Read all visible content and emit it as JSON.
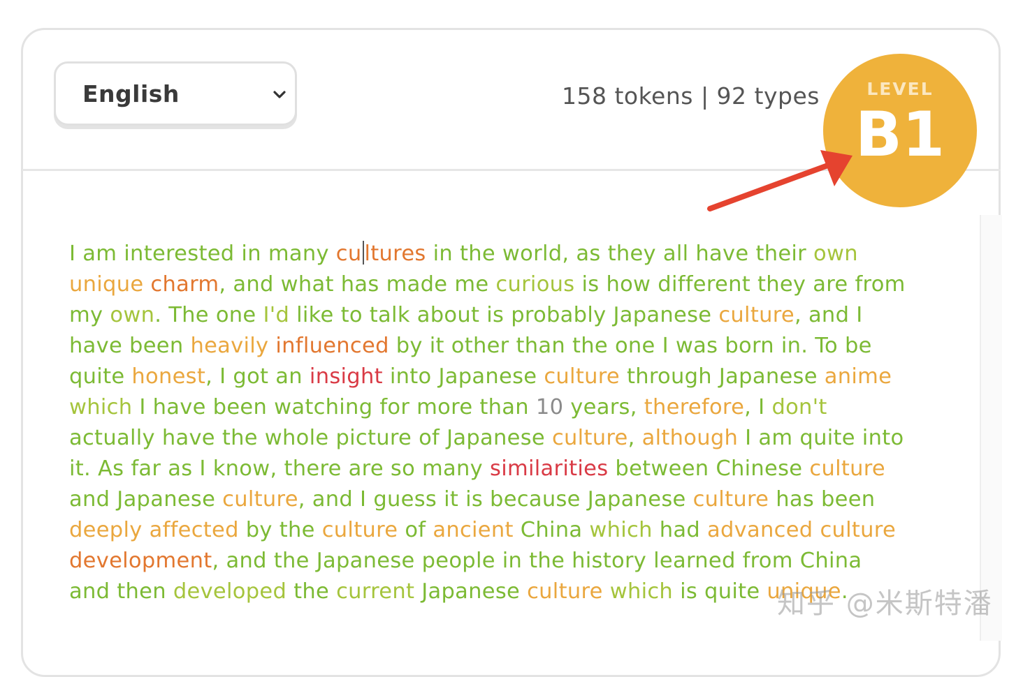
{
  "language_select": {
    "value": "English"
  },
  "stats": {
    "text": "158 tokens | 92 types"
  },
  "level": {
    "label": "LEVEL",
    "value": "B1",
    "color": "#efb23b"
  },
  "level_colors": {
    "green": "#7cba34",
    "yellow_green": "#a5c43c",
    "orange": "#eaa73e",
    "dark_orange": "#e2772f",
    "red": "#d93a45",
    "grey": "#8a8a8a"
  },
  "text_lines": [
    [
      [
        "I am interested in many ",
        "g"
      ],
      [
        "cu",
        "d"
      ],
      [
        "|caret",
        "caret"
      ],
      [
        "ltures",
        "d"
      ],
      [
        " in the world, as they all have their ",
        "g"
      ],
      [
        "own",
        "y"
      ]
    ],
    [
      [
        "unique",
        "o"
      ],
      [
        " ",
        "g"
      ],
      [
        "charm",
        "d"
      ],
      [
        ", and what has made me ",
        "g"
      ],
      [
        "curious",
        "y"
      ],
      [
        " is how different they are from",
        "g"
      ]
    ],
    [
      [
        "my ",
        "g"
      ],
      [
        "own",
        "y"
      ],
      [
        ". The one ",
        "g"
      ],
      [
        "I'd",
        "y"
      ],
      [
        " like to talk about is probably Japanese ",
        "g"
      ],
      [
        "culture",
        "o"
      ],
      [
        ", and I",
        "g"
      ]
    ],
    [
      [
        "have been ",
        "g"
      ],
      [
        "heavily",
        "o"
      ],
      [
        " ",
        "g"
      ],
      [
        "influenced",
        "d"
      ],
      [
        " by it other than the one I was born in. To be",
        "g"
      ]
    ],
    [
      [
        "quite ",
        "g"
      ],
      [
        "honest",
        "o"
      ],
      [
        ", I got an ",
        "g"
      ],
      [
        "insight",
        "r"
      ],
      [
        " into Japanese ",
        "g"
      ],
      [
        "culture",
        "o"
      ],
      [
        " through Japanese ",
        "g"
      ],
      [
        "anime",
        "o"
      ]
    ],
    [
      [
        "which",
        "y"
      ],
      [
        " I have been watching for more than ",
        "g"
      ],
      [
        "10",
        "n"
      ],
      [
        " years, ",
        "g"
      ],
      [
        "therefore",
        "o"
      ],
      [
        ", I ",
        "g"
      ],
      [
        "don't",
        "y"
      ]
    ],
    [
      [
        "actually have the whole picture of Japanese ",
        "g"
      ],
      [
        "culture",
        "o"
      ],
      [
        ", ",
        "g"
      ],
      [
        "although",
        "o"
      ],
      [
        " I am quite into",
        "g"
      ]
    ],
    [
      [
        "it. As far as I know, there are so many ",
        "g"
      ],
      [
        "similarities",
        "r"
      ],
      [
        " between Chinese ",
        "g"
      ],
      [
        "culture",
        "o"
      ]
    ],
    [
      [
        "and Japanese ",
        "g"
      ],
      [
        "culture",
        "o"
      ],
      [
        ", and I guess it is because Japanese ",
        "g"
      ],
      [
        "culture",
        "o"
      ],
      [
        " has been",
        "g"
      ]
    ],
    [
      [
        "deeply",
        "o"
      ],
      [
        " ",
        "g"
      ],
      [
        "affected",
        "o"
      ],
      [
        " by the ",
        "g"
      ],
      [
        "culture",
        "o"
      ],
      [
        " of ",
        "g"
      ],
      [
        "ancient",
        "o"
      ],
      [
        " China ",
        "g"
      ],
      [
        "which",
        "y"
      ],
      [
        " had ",
        "g"
      ],
      [
        "advanced",
        "o"
      ],
      [
        " ",
        "g"
      ],
      [
        "culture",
        "o"
      ]
    ],
    [
      [
        "development",
        "d"
      ],
      [
        ", and the Japanese people in the history learned from China",
        "g"
      ]
    ],
    [
      [
        "and then ",
        "g"
      ],
      [
        "developed",
        "y"
      ],
      [
        " the ",
        "g"
      ],
      [
        "current",
        "y"
      ],
      [
        " Japanese ",
        "g"
      ],
      [
        "culture",
        "o"
      ],
      [
        " ",
        "g"
      ],
      [
        "which",
        "y"
      ],
      [
        " is quite ",
        "g"
      ],
      [
        "unique",
        "o"
      ],
      [
        ".",
        "g"
      ]
    ]
  ],
  "watermark": {
    "text": "知乎 @米斯特潘"
  }
}
